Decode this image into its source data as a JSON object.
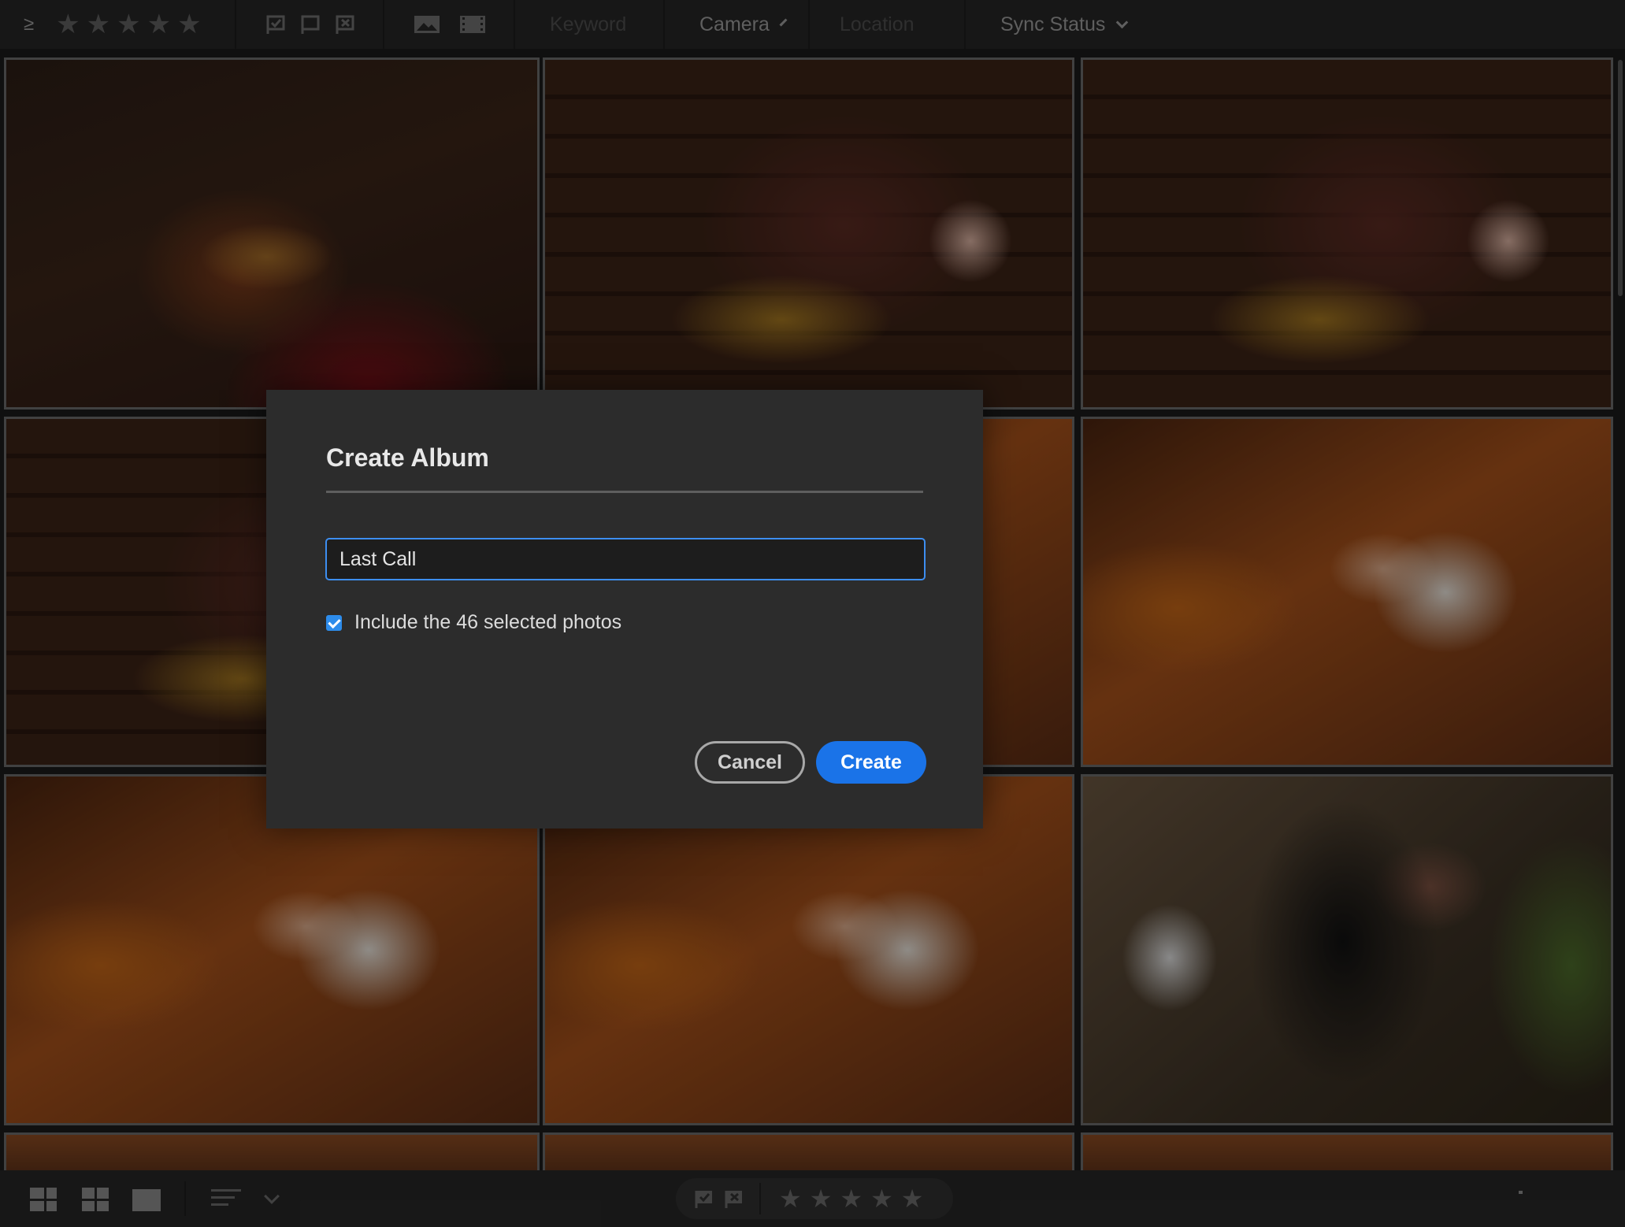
{
  "toolbar": {
    "collapse_glyph": "≥",
    "rating_stars": [
      "★",
      "★",
      "★",
      "★",
      "★"
    ],
    "flag_icons": [
      "flag-picked-icon",
      "flag-icon",
      "flag-rejected-icon"
    ],
    "media_icons": [
      "photo-icon",
      "video-icon"
    ],
    "keyword_placeholder": "Keyword",
    "camera_label": "Camera",
    "location_placeholder": "Location",
    "sync_label": "Sync Status"
  },
  "grid": {
    "rows": 3,
    "columns": 3,
    "tiles": [
      {
        "name": "guitar-player",
        "style": "ph-guitar"
      },
      {
        "name": "saxophone-player",
        "style": "ph-sax"
      },
      {
        "name": "saxophone-player",
        "style": "ph-sax"
      },
      {
        "name": "saxophone-player",
        "style": "ph-sax"
      },
      {
        "name": "bass-player",
        "style": "ph-bass"
      },
      {
        "name": "bass-player",
        "style": "ph-bass"
      },
      {
        "name": "bass-player",
        "style": "ph-bass"
      },
      {
        "name": "bass-player",
        "style": "ph-bass"
      },
      {
        "name": "drummer",
        "style": "ph-drum"
      }
    ]
  },
  "dialog": {
    "title": "Create Album",
    "album_name_value": "Last Call",
    "include_label": "Include the 46 selected photos",
    "include_checked": true,
    "cancel_label": "Cancel",
    "create_label": "Create",
    "accent_color": "#1a73e8"
  },
  "bottombar": {
    "view_icons": [
      "mosaic-view-icon",
      "square-grid-view-icon",
      "single-view-icon"
    ],
    "sort_icon": "sort-icon",
    "rating_stars": [
      "★",
      "★",
      "★",
      "★",
      "★"
    ],
    "flag_icons": [
      "flag-picked-icon",
      "flag-rejected-icon"
    ]
  }
}
